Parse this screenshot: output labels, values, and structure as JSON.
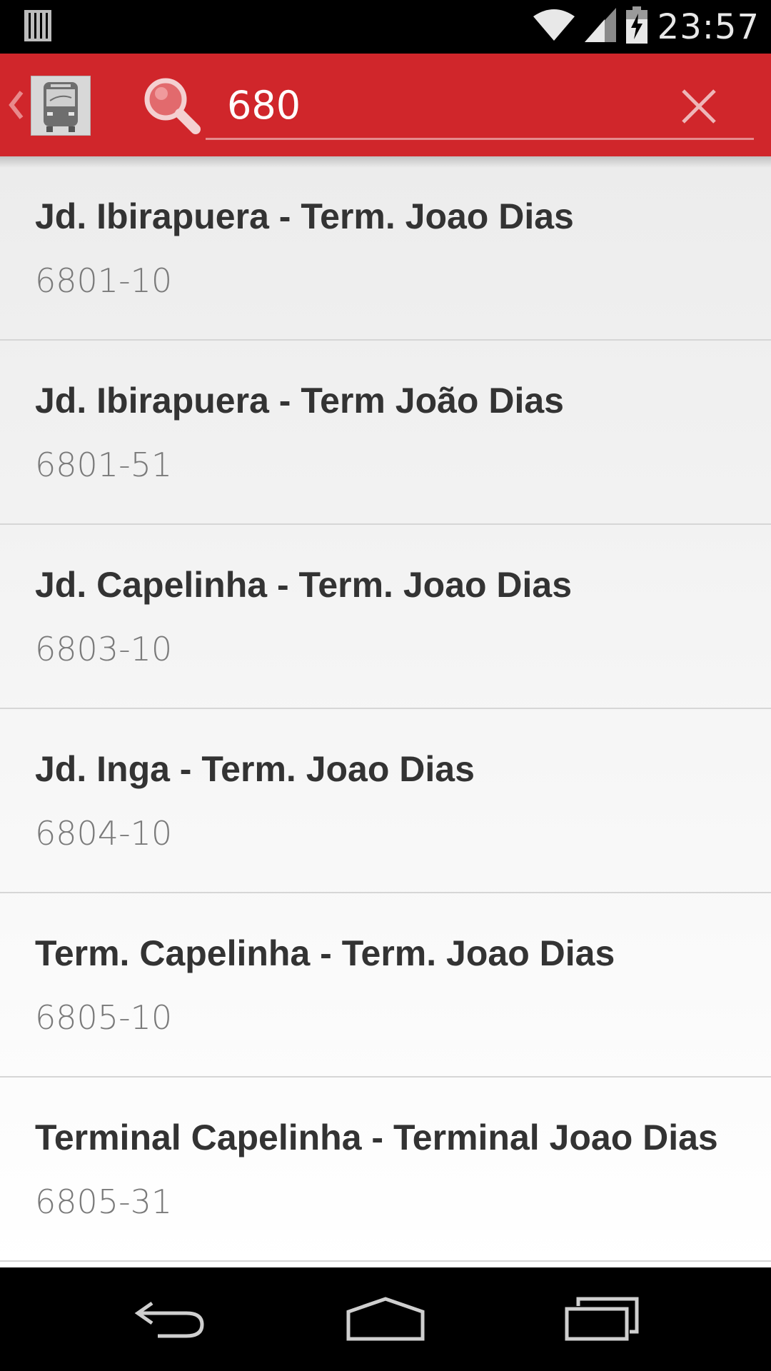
{
  "status_bar": {
    "time": "23:57",
    "icons": [
      "notification-bars-icon",
      "wifi-icon",
      "signal-icon",
      "battery-charging-icon"
    ]
  },
  "app_bar": {
    "logo_icon": "bus-icon",
    "search_icon": "magnifier-icon",
    "search_value": "680",
    "clear_icon": "close-icon",
    "color": "#d0262b"
  },
  "results": [
    {
      "title": "Jd. Ibirapuera - Term. Joao Dias",
      "code": "6801-10"
    },
    {
      "title": "Jd. Ibirapuera - Term João Dias",
      "code": "6801-51"
    },
    {
      "title": "Jd. Capelinha - Term. Joao Dias",
      "code": "6803-10"
    },
    {
      "title": "Jd. Inga - Term. Joao Dias",
      "code": "6804-10"
    },
    {
      "title": "Term. Capelinha - Term. Joao Dias",
      "code": "6805-10"
    },
    {
      "title": "Terminal Capelinha - Terminal Joao Dias",
      "code": "6805-31"
    }
  ],
  "nav_bar": {
    "icons": [
      "back-icon",
      "home-icon",
      "recents-icon"
    ]
  }
}
